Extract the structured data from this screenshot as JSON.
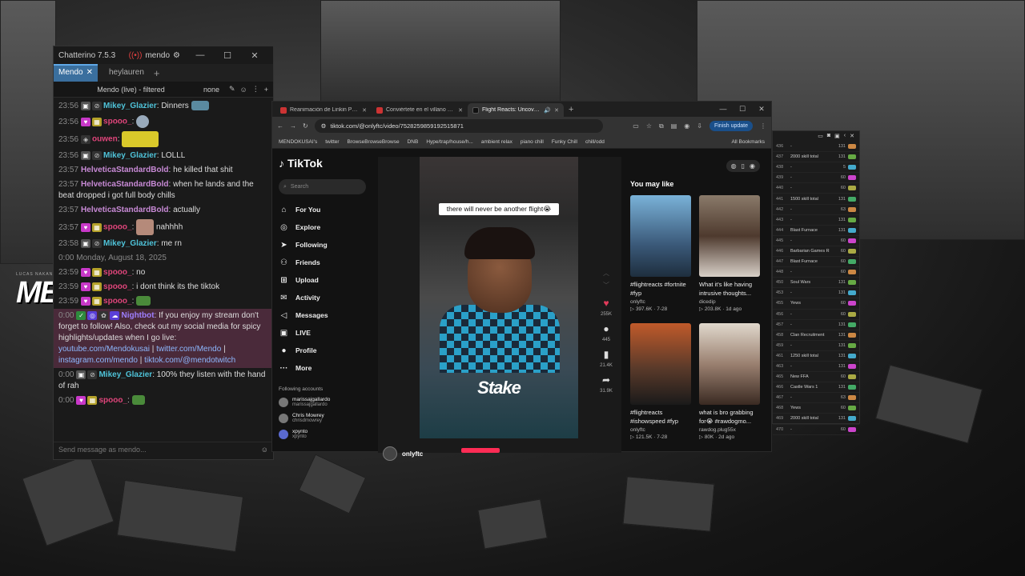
{
  "chatterino": {
    "app_title": "Chatterino 7.5.3",
    "user": "mendo",
    "tabs": [
      {
        "label": "Mendo",
        "active": true
      },
      {
        "label": "heylauren",
        "active": false
      }
    ],
    "split_title": "Mendo (live) - filtered",
    "split_mode": "none",
    "input_placeholder": "Send message as mendo...",
    "messages": [
      {
        "ts": "23:56",
        "user": "Mikey_Glazier",
        "user_color": "#4fc3d9",
        "text": "Dinners"
      },
      {
        "ts": "23:56",
        "user": "spooo_",
        "user_color": "#e0457b",
        "text": ""
      },
      {
        "ts": "23:56",
        "user": "ouwen",
        "user_color": "#e0457b",
        "text": ""
      },
      {
        "ts": "23:56",
        "user": "Mikey_Glazier",
        "user_color": "#4fc3d9",
        "text": "LOLLL"
      },
      {
        "ts": "23:57",
        "user": "HelveticaStandardBold",
        "user_color": "#c88ad6",
        "text": "he killed that shit"
      },
      {
        "ts": "23:57",
        "user": "HelveticaStandardBold",
        "user_color": "#c88ad6",
        "text": "when he lands and the beat dropped i got full body chills"
      },
      {
        "ts": "23:57",
        "user": "HelveticaStandardBold",
        "user_color": "#c88ad6",
        "text": "actually"
      },
      {
        "ts": "23:57",
        "user": "spooo_",
        "user_color": "#e0457b",
        "text": "nahhhh"
      },
      {
        "ts": "23:58",
        "user": "Mikey_Glazier",
        "user_color": "#4fc3d9",
        "text": "me rn"
      },
      {
        "ts": "23:59",
        "user": "spooo_",
        "user_color": "#e0457b",
        "text": "no"
      },
      {
        "ts": "23:59",
        "user": "spooo_",
        "user_color": "#e0457b",
        "text": "i dont think its the tiktok"
      },
      {
        "ts": "23:59",
        "user": "spooo_",
        "user_color": "#e0457b",
        "text": ""
      }
    ],
    "date_separator": "0:00 Monday, August 18, 2025",
    "bot_message": {
      "ts": "0:00",
      "user": "Nightbot",
      "user_color": "#9f7fff",
      "text": "If you enjoy my stream don't forget to follow! Also, check out my social media for spicy highlights/updates when I go live:",
      "link1": "youtube.com/Mendokusai",
      "link2": "twitter.com/Mendo",
      "link3": "instagram.com/mendo",
      "link4": "tiktok.com/@mendotwitch",
      "sep": "|"
    },
    "after_messages": [
      {
        "ts": "0:00",
        "user": "Mikey_Glazier",
        "user_color": "#4fc3d9",
        "text": "100% they listen with the hand of rah"
      },
      {
        "ts": "0:00",
        "user": "spooo_",
        "user_color": "#e0457b",
        "text": ""
      }
    ]
  },
  "browser": {
    "tabs": [
      {
        "title": "Reanimación de Linkin Park: M",
        "active": false
      },
      {
        "title": "Conviértete en el villano de tu",
        "active": false
      },
      {
        "title": "Flight Reacts: Uncovering M",
        "active": true
      }
    ],
    "url": "tiktok.com/@onlyftc/video/7528259859192515871",
    "finish_update": "Finish update",
    "bookmarks": [
      "MENDOKUSAI's",
      "twitter",
      "BrowseBrowseBrowse",
      "DNB",
      "Hype/trap/house/h...",
      "ambient relax",
      "piano chill",
      "Funky Chill",
      "chill/odd"
    ],
    "all_bookmarks": "All Bookmarks"
  },
  "tiktok": {
    "logo": "TikTok",
    "search_placeholder": "Search",
    "nav": [
      {
        "label": "For You",
        "icon": "home-icon"
      },
      {
        "label": "Explore",
        "icon": "compass-icon"
      },
      {
        "label": "Following",
        "icon": "following-icon"
      },
      {
        "label": "Friends",
        "icon": "friends-icon"
      },
      {
        "label": "Upload",
        "icon": "upload-icon"
      },
      {
        "label": "Activity",
        "icon": "activity-icon"
      },
      {
        "label": "Messages",
        "icon": "messages-icon"
      },
      {
        "label": "LIVE",
        "icon": "live-icon"
      },
      {
        "label": "Profile",
        "icon": "profile-icon"
      },
      {
        "label": "More",
        "icon": "more-icon"
      }
    ],
    "following_title": "Following accounts",
    "following": [
      {
        "name": "marissajgallardo",
        "handle": "marissajgallardo"
      },
      {
        "name": "Chris Mowrey",
        "handle": "chrisdmowrey"
      },
      {
        "name": "xpynto",
        "handle": "xpynto"
      }
    ],
    "video": {
      "caption": "there will never be another flight😭",
      "overlay": "Stake",
      "author": "onlyftc",
      "likes": "255K",
      "comments": "445",
      "saves": "21.4K",
      "shares": "31.9K"
    },
    "you_may_like": "You may like",
    "cards": [
      {
        "caption": "#flightreacts #fortnite #fyp",
        "author": "onlyftc",
        "views": "397.6K",
        "date": "7-28",
        "color": "#3b5a7a"
      },
      {
        "caption": "What it's like having intrusive thoughts...",
        "author": "dicedip",
        "views": "203.8K",
        "date": "1d ago",
        "color": "#6a5a4a"
      },
      {
        "caption": "#flightreacts #ishowspeed #fyp",
        "author": "onlyftc",
        "views": "121.5K",
        "date": "7-28",
        "color": "#5a3a2a"
      },
      {
        "caption": "what is bro grabbing for😭 #rawdogmo...",
        "author": "rawdog.plug55x",
        "views": "80K",
        "date": "2d ago",
        "color": "#c9c2b5"
      }
    ]
  },
  "sidelist": {
    "rows": [
      {
        "n": "436",
        "t": "-",
        "v": "131"
      },
      {
        "n": "437",
        "t": "2000 skill total",
        "v": "131"
      },
      {
        "n": "438",
        "t": "-",
        "v": "5"
      },
      {
        "n": "439",
        "t": "-",
        "v": "60"
      },
      {
        "n": "440",
        "t": "-",
        "v": "60"
      },
      {
        "n": "441",
        "t": "1500 skill total",
        "v": "131"
      },
      {
        "n": "442",
        "t": "-",
        "v": "63"
      },
      {
        "n": "443",
        "t": "-",
        "v": "131"
      },
      {
        "n": "444",
        "t": "Blast Furnace",
        "v": "131"
      },
      {
        "n": "445",
        "t": "-",
        "v": "60"
      },
      {
        "n": "446",
        "t": "Barbarian Games R",
        "v": "60"
      },
      {
        "n": "447",
        "t": "Blast Furnace",
        "v": "60"
      },
      {
        "n": "448",
        "t": "-",
        "v": "60"
      },
      {
        "n": "450",
        "t": "Soul Wars",
        "v": "131"
      },
      {
        "n": "453",
        "t": "-",
        "v": "131"
      },
      {
        "n": "455",
        "t": "Yews",
        "v": "60"
      },
      {
        "n": "456",
        "t": "-",
        "v": "60"
      },
      {
        "n": "457",
        "t": "-",
        "v": "131"
      },
      {
        "n": "458",
        "t": "Clan Recruitment",
        "v": "131"
      },
      {
        "n": "459",
        "t": "-",
        "v": "131"
      },
      {
        "n": "461",
        "t": "1250 skill total",
        "v": "131"
      },
      {
        "n": "463",
        "t": "-",
        "v": "131"
      },
      {
        "n": "465",
        "t": "New FFA",
        "v": "60"
      },
      {
        "n": "466",
        "t": "Castle Wars 1",
        "v": "131"
      },
      {
        "n": "467",
        "t": "-",
        "v": "63"
      },
      {
        "n": "468",
        "t": "Yews",
        "v": "60"
      },
      {
        "n": "469",
        "t": "2000 skill total",
        "v": "131"
      },
      {
        "n": "470",
        "t": "-",
        "v": "60"
      }
    ]
  },
  "logo": {
    "small_line": "LUCAS NAKANISHI",
    "big": "MENDO"
  }
}
